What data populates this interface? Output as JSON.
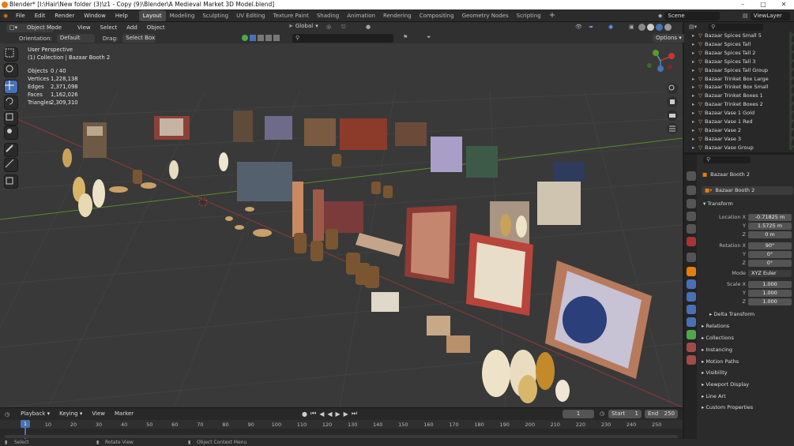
{
  "title": "Blender* [I:\\Hair\\New folder (3)\\z1 - Copy (9)\\Blender\\A Medieval Market 3D Model.blend]",
  "menus": [
    "File",
    "Edit",
    "Render",
    "Window",
    "Help"
  ],
  "workspaces": [
    "Layout",
    "Modeling",
    "Sculpting",
    "UV Editing",
    "Texture Paint",
    "Shading",
    "Animation",
    "Rendering",
    "Compositing",
    "Geometry Nodes",
    "Scripting"
  ],
  "scene": "Scene",
  "view_layer": "ViewLayer",
  "vp_header": {
    "mode": "Object Mode",
    "menus": [
      "View",
      "Select",
      "Add",
      "Object"
    ],
    "transform": "Global"
  },
  "tool_header": {
    "orientation_label": "Orientation:",
    "orientation": "Default",
    "drag_label": "Drag:",
    "drag": "Select Box",
    "options": "Options"
  },
  "viewport": {
    "perspective": "User Perspective",
    "collection": "(1) Collection | Bazaar Booth 2"
  },
  "stats": [
    {
      "label": "Objects",
      "value": "0 / 40"
    },
    {
      "label": "Vertices",
      "value": "1,228,138"
    },
    {
      "label": "Edges",
      "value": "2,371,098"
    },
    {
      "label": "Faces",
      "value": "1,162,026"
    },
    {
      "label": "Triangles",
      "value": "2,309,310"
    }
  ],
  "outliner": [
    "Bazaar Spices Small 5",
    "Bazaar Spices Tall",
    "Bazaar Spices Tall 2",
    "Bazaar Spices Tall 3",
    "Bazaar Spices Tall Group",
    "Bazaar Trinket Box Large",
    "Bazaar Trinket Box Small",
    "Bazaar Trinket Boxes 1",
    "Bazaar Trinket Boxes 2",
    "Bazaar Vase 1 Gold",
    "Bazaar Vase 1 Red",
    "Bazaar Vase 2",
    "Bazaar Vase 3",
    "Bazaar Vase Group"
  ],
  "properties": {
    "object_name": "Bazaar Booth 2",
    "data_name": "Bazaar Booth 2",
    "transform_header": "Transform",
    "location_label": "Location X",
    "location": [
      "-0.71825 m",
      "1.5725 m",
      "0 m"
    ],
    "rotation_label": "Rotation X",
    "rotation": [
      "90°",
      "0°",
      "0°"
    ],
    "mode_label": "Mode",
    "mode": "XYZ Euler",
    "scale_label": "Scale X",
    "scale": [
      "1.000",
      "1.000",
      "1.000"
    ],
    "axis_y": "Y",
    "axis_z": "Z",
    "delta": "Delta Transform",
    "panels": [
      "Relations",
      "Collections",
      "Instancing",
      "Motion Paths",
      "Visibility",
      "Viewport Display",
      "Line Art",
      "Custom Properties"
    ]
  },
  "timeline": {
    "menus": [
      "Playback",
      "Keying",
      "View",
      "Marker"
    ],
    "current_frame": "1",
    "start_label": "Start",
    "start": "1",
    "end_label": "End",
    "end": "250",
    "ticks": [
      "1",
      "10",
      "20",
      "30",
      "40",
      "50",
      "60",
      "70",
      "80",
      "90",
      "100",
      "110",
      "120",
      "130",
      "140",
      "150",
      "160",
      "170",
      "180",
      "190",
      "200",
      "210",
      "220",
      "230",
      "240",
      "250"
    ]
  },
  "statusbar": [
    "Select",
    "Rotate View",
    "Object Context Menu"
  ],
  "colors": {
    "accent": "#4772b3",
    "header": "#303030",
    "viewport_bg": "#393939",
    "x_axis": "#8b3a3a",
    "y_axis": "#5b8a2a"
  }
}
